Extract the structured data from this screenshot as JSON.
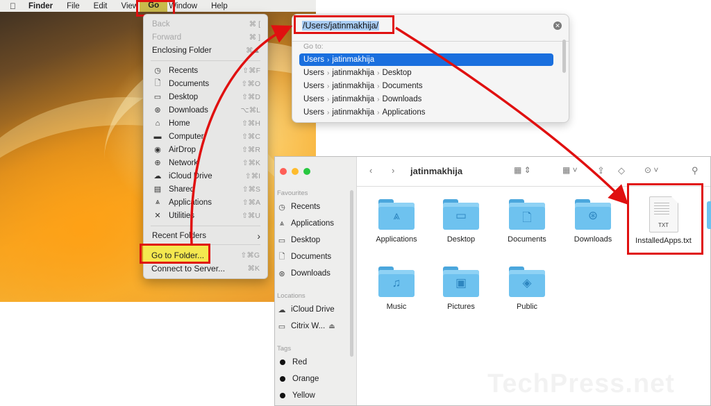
{
  "menubar": {
    "apple_icon": "apple-icon",
    "app": "Finder",
    "items": [
      "File",
      "Edit",
      "View",
      "Go",
      "Window",
      "Help"
    ]
  },
  "go_menu": {
    "items": [
      {
        "label": "Back",
        "shortcut": "⌘ [",
        "disabled": true
      },
      {
        "label": "Forward",
        "shortcut": "⌘ ]",
        "disabled": true
      },
      {
        "label": "Enclosing Folder",
        "shortcut": "⌘▲"
      },
      {
        "label": "Recents",
        "icon": "clock-icon",
        "shortcut": "⇧⌘F"
      },
      {
        "label": "Documents",
        "icon": "document-icon",
        "shortcut": "⇧⌘O"
      },
      {
        "label": "Desktop",
        "icon": "desktop-icon",
        "shortcut": "⇧⌘D"
      },
      {
        "label": "Downloads",
        "icon": "download-icon",
        "shortcut": "⌥⌘L"
      },
      {
        "label": "Home",
        "icon": "home-icon",
        "shortcut": "⇧⌘H"
      },
      {
        "label": "Computer",
        "icon": "laptop-icon",
        "shortcut": "⇧⌘C"
      },
      {
        "label": "AirDrop",
        "icon": "airdrop-icon",
        "shortcut": "⇧⌘R"
      },
      {
        "label": "Network",
        "icon": "network-icon",
        "shortcut": "⇧⌘K"
      },
      {
        "label": "iCloud Drive",
        "icon": "cloud-icon",
        "shortcut": "⇧⌘I"
      },
      {
        "label": "Shared",
        "icon": "shared-folder-icon",
        "shortcut": "⇧⌘S"
      },
      {
        "label": "Applications",
        "icon": "applications-icon",
        "shortcut": "⇧⌘A"
      },
      {
        "label": "Utilities",
        "icon": "tools-icon",
        "shortcut": "⇧⌘U"
      },
      {
        "label": "Recent Folders",
        "submenu_glyph": "›"
      },
      {
        "label": "Go to Folder...",
        "shortcut": "⇧⌘G",
        "highlighted": true
      },
      {
        "label": "Connect to Server...",
        "shortcut": "⌘K"
      }
    ]
  },
  "goto_panel": {
    "path": "/Users/jatinmakhija/",
    "label": "Go to:",
    "suggestions": [
      {
        "parts": [
          "Users",
          "jatinmakhija"
        ],
        "selected": true
      },
      {
        "parts": [
          "Users",
          "jatinmakhija",
          "Desktop"
        ]
      },
      {
        "parts": [
          "Users",
          "jatinmakhija",
          "Documents"
        ]
      },
      {
        "parts": [
          "Users",
          "jatinmakhija",
          "Downloads"
        ]
      },
      {
        "parts": [
          "Users",
          "jatinmakhija",
          "Applications"
        ]
      }
    ]
  },
  "finder": {
    "title": "jatinmakhija",
    "sidebar": {
      "favourites_header": "Favourites",
      "favourites": [
        {
          "label": "Recents",
          "icon": "clock-icon"
        },
        {
          "label": "Applications",
          "icon": "applications-icon"
        },
        {
          "label": "Desktop",
          "icon": "desktop-icon"
        },
        {
          "label": "Documents",
          "icon": "document-icon"
        },
        {
          "label": "Downloads",
          "icon": "download-icon"
        }
      ],
      "locations_header": "Locations",
      "locations": [
        {
          "label": "iCloud Drive",
          "icon": "cloud-icon"
        },
        {
          "label": "Citrix W...",
          "icon": "drive-icon",
          "eject": "⏏"
        }
      ],
      "tags_header": "Tags",
      "tags": [
        "Red",
        "Orange",
        "Yellow"
      ]
    },
    "items": [
      {
        "name": "Applications",
        "icon": "applications-folder-icon"
      },
      {
        "name": "Desktop",
        "icon": "desktop-folder-icon"
      },
      {
        "name": "Documents",
        "icon": "documents-folder-icon"
      },
      {
        "name": "Downloads",
        "icon": "downloads-folder-icon"
      },
      {
        "name": "InstalledApps.txt",
        "icon": "text-file-icon",
        "ext": "TXT"
      },
      {
        "name": "Music",
        "icon": "music-folder-icon"
      },
      {
        "name": "Pictures",
        "icon": "pictures-folder-icon"
      },
      {
        "name": "Public",
        "icon": "public-folder-icon"
      }
    ]
  },
  "watermark": "TechPress.net",
  "colors": {
    "annotation": "#e01010",
    "selection": "#1a6fde",
    "highlight": "#f4e84f",
    "folder": "#6ec2ef"
  }
}
